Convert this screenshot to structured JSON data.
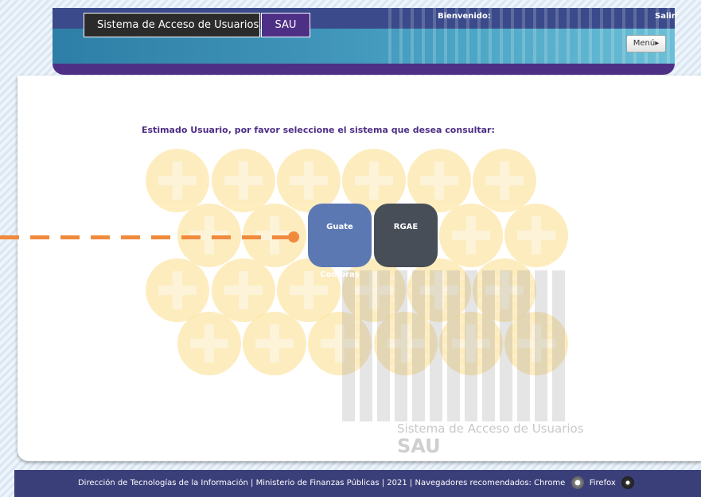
{
  "header": {
    "app_title": "Sistema de Acceso de Usuarios",
    "app_acronym": "SAU",
    "welcome": "Bienvenido:",
    "exit": "Salir",
    "menu": "Menú▸"
  },
  "main": {
    "instruction": "Estimado Usuario, por favor seleccione el sistema que desea consultar:",
    "systems": [
      {
        "label": "Guate Compras"
      },
      {
        "label": "RGAE"
      }
    ]
  },
  "watermark": {
    "name": "Sistema de Acceso de Usuarios",
    "acronym": "SAU"
  },
  "footer": {
    "text": "Dirección de Tecnologías de la Información | Ministerio de Finanzas Públicas | 2021 | Navegadores recomendados: Chrome",
    "firefox": "Firefox"
  },
  "icons": [
    "chrome-icon",
    "firefox-icon"
  ],
  "colors": {
    "brand_purple": "#4e2f86",
    "header_dark": "#2b2b2b",
    "guate_compras": "#5c78b3",
    "rgae": "#474e58",
    "annotation_orange": "#f08a3c"
  }
}
